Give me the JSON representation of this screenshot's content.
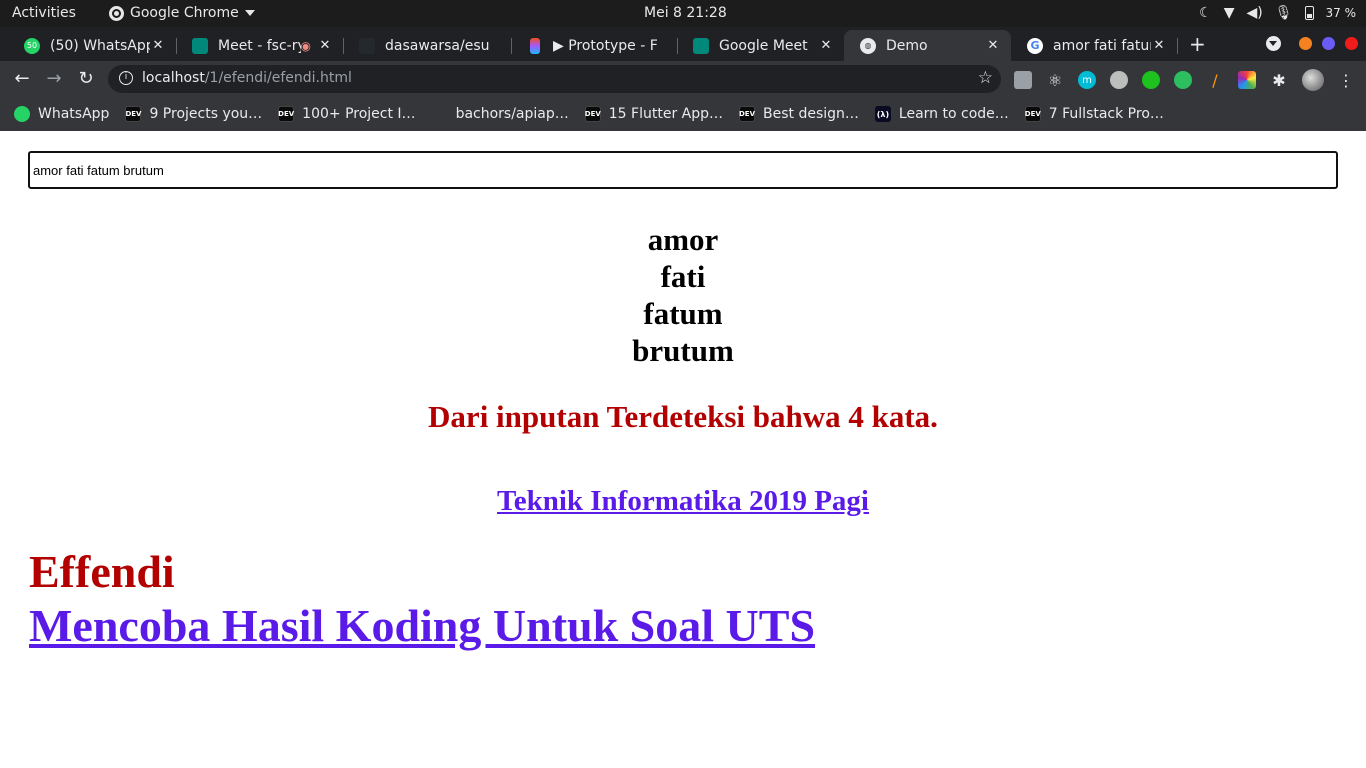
{
  "system_bar": {
    "activities": "Activities",
    "app_name": "Google Chrome",
    "clock": "Mei 8  21:28",
    "battery": "37 %"
  },
  "tabs": [
    {
      "title": "(50) WhatsApp",
      "icon": "whatsapp-icon",
      "color": "#25d366"
    },
    {
      "title": "Meet - fsc-ry",
      "icon": "google-meet-icon",
      "color": "#00897b"
    },
    {
      "title": "dasawarsa/esu",
      "icon": "github-icon",
      "color": "#24292e"
    },
    {
      "title": "▶ Prototype - F",
      "icon": "figma-icon",
      "color": "#f24e1e"
    },
    {
      "title": "Google Meet",
      "icon": "google-meet-icon",
      "color": "#00897b"
    },
    {
      "title": "Demo",
      "icon": "globe-icon",
      "color": "#5f6368",
      "active": true
    },
    {
      "title": "amor fati fatum",
      "icon": "google-icon",
      "color": "#4285f4"
    }
  ],
  "toolbar": {
    "url_host": "localhost",
    "url_path": "/1/efendi/efendi.html"
  },
  "bookmarks": [
    {
      "label": "WhatsApp",
      "icon": "whatsapp-icon"
    },
    {
      "label": "9 Projects you…",
      "icon": "dev-icon"
    },
    {
      "label": "100+ Project I…",
      "icon": "dev-icon"
    },
    {
      "label": "bachors/apiap…",
      "icon": "github-icon"
    },
    {
      "label": "15 Flutter App…",
      "icon": "dev-icon"
    },
    {
      "label": "Best design…",
      "icon": "dev-icon"
    },
    {
      "label": "Learn to code…",
      "icon": "freecodecamp-icon"
    },
    {
      "label": "7 Fullstack Pro…",
      "icon": "dev-icon"
    }
  ],
  "page": {
    "input_value": "amor fati fatum brutum",
    "words": [
      "amor",
      "fati",
      "fatum",
      "brutum"
    ],
    "result": "Dari inputan Terdeteksi bahwa 4 kata.",
    "class_link": "Teknik Informatika 2019 Pagi",
    "name": "Effendi",
    "uts_link": "Mencoba Hasil Koding Untuk Soal UTS"
  },
  "colors": {
    "accent_red": "#b30000",
    "link_purple": "#5a1ae8"
  }
}
